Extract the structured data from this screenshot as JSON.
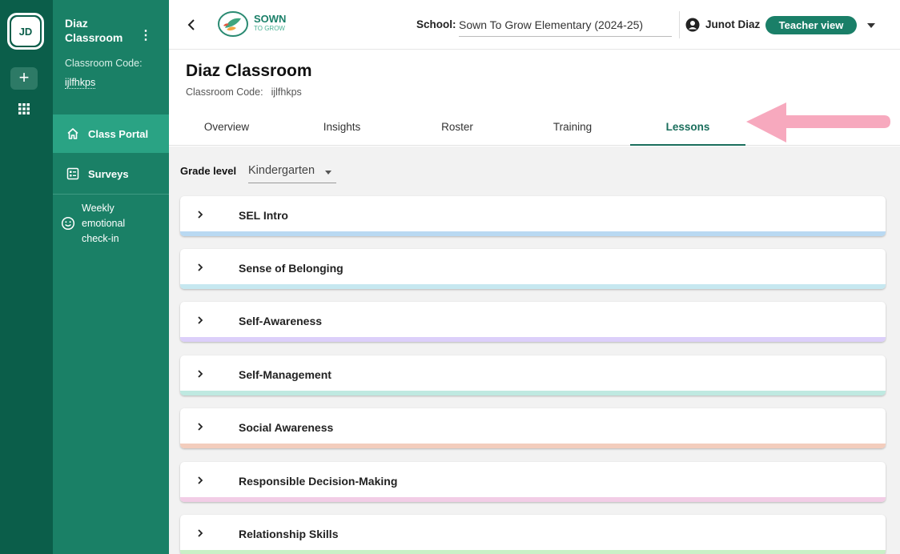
{
  "rail": {
    "avatar_initials": "JD",
    "add_label": "+"
  },
  "sidebar": {
    "title": "Diaz Classroom",
    "code_label": "Classroom Code:",
    "code_value": "ijlfhkps",
    "items": [
      {
        "label": "Class Portal",
        "icon": "home-icon",
        "active": true
      },
      {
        "label": "Surveys",
        "icon": "survey-icon",
        "active": false
      },
      {
        "label": "Weekly emotional check-in",
        "icon": "smiley-icon",
        "active": false
      }
    ]
  },
  "topbar": {
    "logo_line1": "SOWN",
    "logo_line2": "TO GROW",
    "school_label": "School:",
    "school_value": "Sown To Grow Elementary (2024-25)",
    "user_name": "Junot Diaz",
    "view_button": "Teacher view"
  },
  "header": {
    "title": "Diaz Classroom",
    "code_label": "Classroom Code:",
    "code_value": "ijlfhkps"
  },
  "tabs": [
    {
      "label": "Overview",
      "active": false
    },
    {
      "label": "Insights",
      "active": false
    },
    {
      "label": "Roster",
      "active": false
    },
    {
      "label": "Training",
      "active": false
    },
    {
      "label": "Lessons",
      "active": true
    }
  ],
  "grade": {
    "label": "Grade level",
    "value": "Kindergarten"
  },
  "lessons": [
    {
      "title": "SEL Intro",
      "color": "#b9d9f2"
    },
    {
      "title": "Sense of Belonging",
      "color": "#c6e8f0"
    },
    {
      "title": "Self-Awareness",
      "color": "#dccffa"
    },
    {
      "title": "Self-Management",
      "color": "#bfe9e1"
    },
    {
      "title": "Social Awareness",
      "color": "#f3cdbd"
    },
    {
      "title": "Responsible Decision-Making",
      "color": "#f2cde6"
    },
    {
      "title": "Relationship Skills",
      "color": "#c9f0c6"
    }
  ],
  "colors": {
    "brand": "#1a7f68",
    "rail": "#0b5e4a",
    "sidebar": "#1a8066",
    "sidebar_active": "#2aa384",
    "annotation_arrow": "#f7a9be"
  }
}
